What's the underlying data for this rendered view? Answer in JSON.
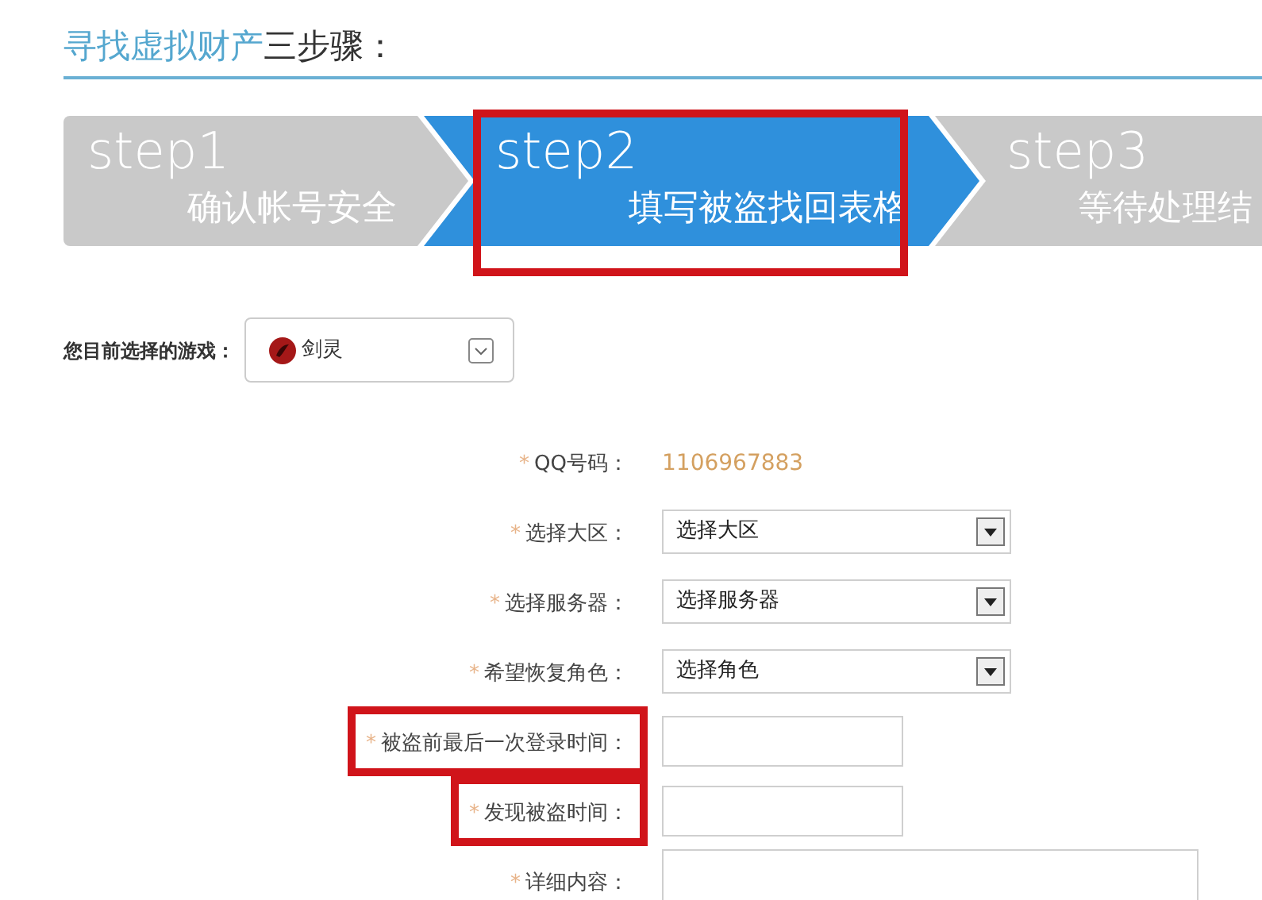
{
  "heading": {
    "part_1": "寻找虚拟财产",
    "part_2": "三步骤："
  },
  "steps": [
    {
      "label": "step1",
      "caption": "确认帐号安全",
      "selected": false,
      "highlighted": false
    },
    {
      "label": "step2",
      "caption": "填写被盗找回表格",
      "selected": true,
      "highlighted": true
    },
    {
      "label": "step3",
      "caption": "等待处理结",
      "selected": false,
      "highlighted": false
    }
  ],
  "game_picker": {
    "label": "您目前选择的游戏：",
    "value": "剑灵"
  },
  "form": [
    {
      "kind": "text",
      "mark": "*",
      "label": "QQ号码：",
      "value": "1106967883",
      "highlighted": false
    },
    {
      "kind": "select",
      "mark": "*",
      "label": "选择大区：",
      "value": "选择大区",
      "highlighted": false
    },
    {
      "kind": "select",
      "mark": "*",
      "label": "选择服务器：",
      "value": "选择服务器",
      "highlighted": false
    },
    {
      "kind": "select",
      "mark": "*",
      "label": "希望恢复角色：",
      "value": "选择角色",
      "highlighted": false
    },
    {
      "kind": "input",
      "mark": "*",
      "label": "被盗前最后一次登录时间：",
      "highlighted": true
    },
    {
      "kind": "input",
      "mark": "*",
      "label": "发现被盗时间：",
      "highlighted": true
    },
    {
      "kind": "textarea",
      "mark": "*",
      "label": "详细内容：",
      "highlighted": false
    }
  ]
}
